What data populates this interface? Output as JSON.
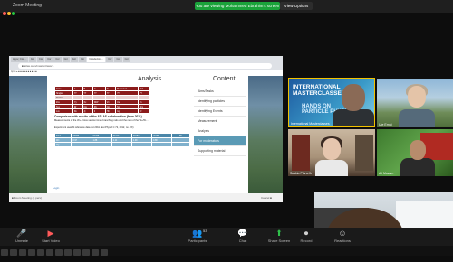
{
  "window": {
    "title": "Zoom Meeting"
  },
  "banner": {
    "share_text": "You are viewing Mohammed Ebrahim's screen",
    "view_options": "View Options"
  },
  "browser": {
    "tabs": [
      "Apps | Cor…",
      "Cor",
      "Cor",
      "Cor",
      "Cor",
      "Cor",
      "Cor",
      "Cor",
      "Introduction…",
      "Cor",
      "Cor",
      "Cor"
    ],
    "address": "■ atlas.cern/masterclass/...",
    "bookmarks": "Apps   ● ■ ■ ■ ■ ■ ■ ■ ■ ■ ■"
  },
  "slide": {
    "title": "Analysis",
    "content_title": "Content",
    "table_rows": [
      [
        "Cxxx",
        "A",
        "B",
        "C",
        "D",
        "Measured",
        "Ref"
      ],
      [
        "Singles",
        "??",
        "??",
        "??",
        "??",
        "??",
        "??"
      ],
      [
        "Partial",
        "",
        "",
        "",
        "",
        "",
        ""
      ],
      [
        "Zxx",
        "Yy",
        "Xx",
        "WW",
        "Vv",
        "Uu",
        "Ts"
      ],
      [
        "Sxx",
        "Rr",
        "Qq",
        "Pp",
        "Oo",
        "Nn",
        "Mm"
      ],
      [
        "Lxx",
        "Kk",
        "Jj",
        "Ii",
        "Hh",
        "Gg",
        "Ff"
      ]
    ],
    "compare_heading": "Comparison with results of the ATLAS collaboration (from 2011)",
    "compare_text": "Measurements of the W+- cross section times branching ratio and the ratio of the W+/W- ...",
    "compare_note": "Experiment uses fit reference data set 2011 (Eur.Phys.J C 72, 2012, no. XX)",
    "table2_rows": [
      [
        "Total",
        "73965",
        "92368",
        "64313",
        "39254",
        "21086",
        "",
        "88"
      ],
      [
        "Wx",
        "0.97",
        "1.88",
        "1.11",
        "1.09",
        "0.88",
        "",
        ""
      ],
      [
        "Wy",
        "",
        "",
        "",
        "",
        "",
        "",
        ""
      ]
    ],
    "footer": "Login",
    "nav": [
      "Aims/Tasks",
      "Identifying particles",
      "Identifying Events",
      "Measurement",
      "Analysis",
      "For moderators",
      "Supporting material"
    ],
    "nav_active": 5
  },
  "bottom_bar": {
    "left": "■ Zoom Meeting (4 pers)",
    "right": "Cancel ■"
  },
  "tiles": [
    {
      "name": "International Masterclasses",
      "line1": "INTERNATIONAL",
      "line2": "MASTERCLASSES",
      "line3": "HANDS ON",
      "line4": "PARTICLE PHYSICS"
    },
    {
      "name": "Ute Ernst"
    },
    {
      "name": "Saskia Plura-Kr"
    },
    {
      "name": "Ali Muzam"
    }
  ],
  "toolbar": {
    "items": [
      {
        "label": "Unmute",
        "icon": "microphone-icon"
      },
      {
        "label": "Start Video",
        "icon": "video-icon"
      },
      {
        "label": "Participants",
        "icon": "participants-icon",
        "count": "53"
      },
      {
        "label": "Chat",
        "icon": "chat-icon"
      },
      {
        "label": "Share Screen",
        "icon": "share-screen-icon"
      },
      {
        "label": "Record",
        "icon": "record-icon"
      },
      {
        "label": "Reactions",
        "icon": "reactions-icon"
      }
    ]
  }
}
